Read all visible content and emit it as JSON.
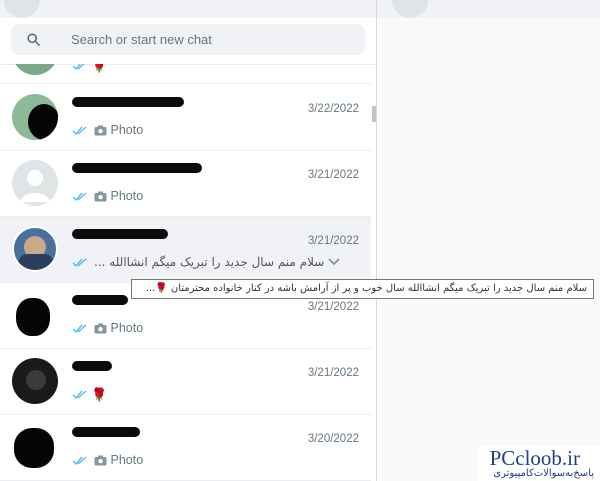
{
  "search": {
    "placeholder": "Search or start new chat"
  },
  "chats": [
    {
      "date": "",
      "preview": "",
      "has_rose": true
    },
    {
      "date": "3/22/2022",
      "preview": "Photo"
    },
    {
      "date": "3/21/2022",
      "preview": "Photo"
    },
    {
      "date": "3/21/2022",
      "preview": "سلام منم سال جدید را تبریک میگم انشاالله ..."
    },
    {
      "date": "3/21/2022",
      "preview": "Photo"
    },
    {
      "date": "3/21/2022",
      "preview": "",
      "has_rose": true
    },
    {
      "date": "3/20/2022",
      "preview": "Photo"
    }
  ],
  "tooltip": {
    "text": "سلام منم سال جدید را تبریک میگم انشاالله سال خوب و پر از آرامش باشه در کنار خانواده محترمتان 🌹..."
  },
  "watermark": {
    "brand": "PCcloob.ir",
    "tagline": "پاسخ‌به‌سوالات‌کامپیوتری"
  },
  "colors": {
    "tick_read": "#53bdeb",
    "rose": "#c0211b",
    "watermark": "#1d3f8a"
  }
}
